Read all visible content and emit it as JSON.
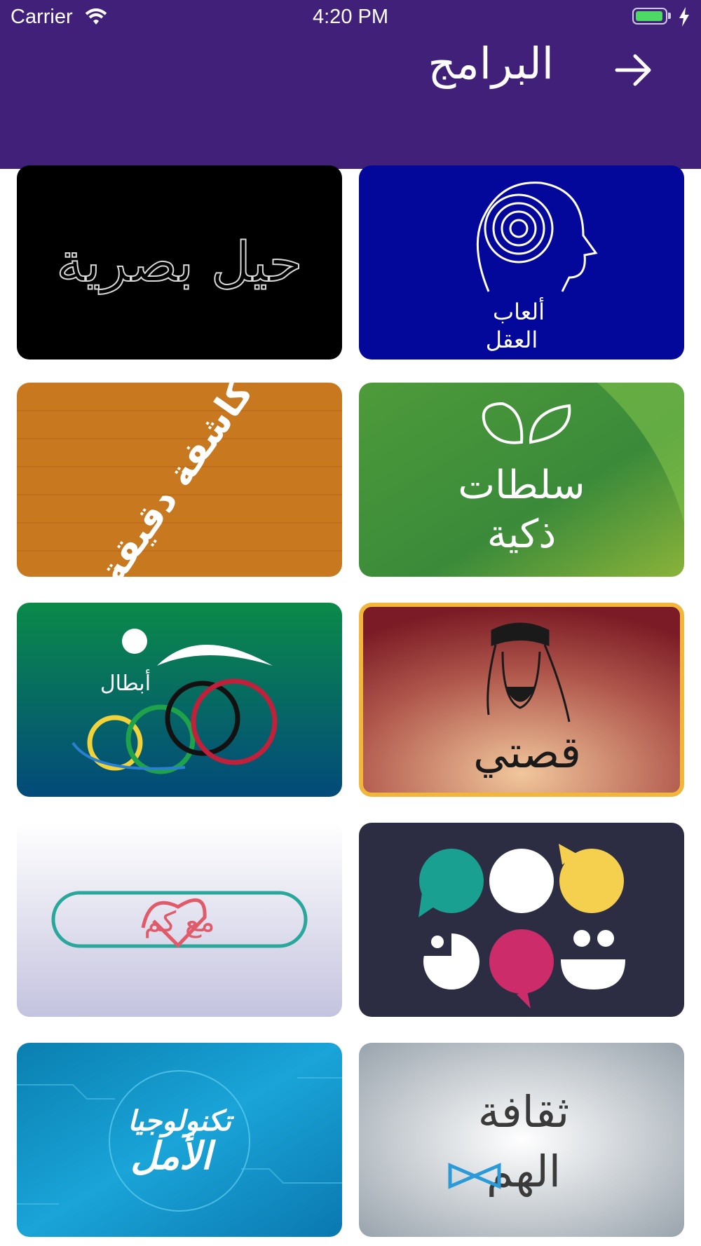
{
  "status_bar": {
    "carrier": "Carrier",
    "time": "4:20 PM",
    "battery_level": 0.95
  },
  "header": {
    "title": "البرامج",
    "back_icon": "arrow-right-icon"
  },
  "programs": [
    {
      "id": "alab-alaql",
      "title_lines": [
        "ألعاب",
        "العقل"
      ]
    },
    {
      "id": "hiyal-basariya",
      "title": "حيل بصرية"
    },
    {
      "id": "salatat-thakiya",
      "title_lines": [
        "سلطات",
        "ذكية"
      ]
    },
    {
      "id": "kashifa-daqiqa",
      "title": "كاشفة دقيقة"
    },
    {
      "id": "qissati",
      "title": "قصتي"
    },
    {
      "id": "abtal",
      "title": "أبطال"
    },
    {
      "id": "thoughts-app",
      "title": ""
    },
    {
      "id": "maa-kam",
      "title": "مع كم"
    },
    {
      "id": "thaqafat-alham",
      "title_lines": [
        "ثقافة",
        "الهم"
      ]
    },
    {
      "id": "technology-alamal",
      "title_lines": [
        "تكنولوجيا",
        "الأمل"
      ]
    }
  ]
}
